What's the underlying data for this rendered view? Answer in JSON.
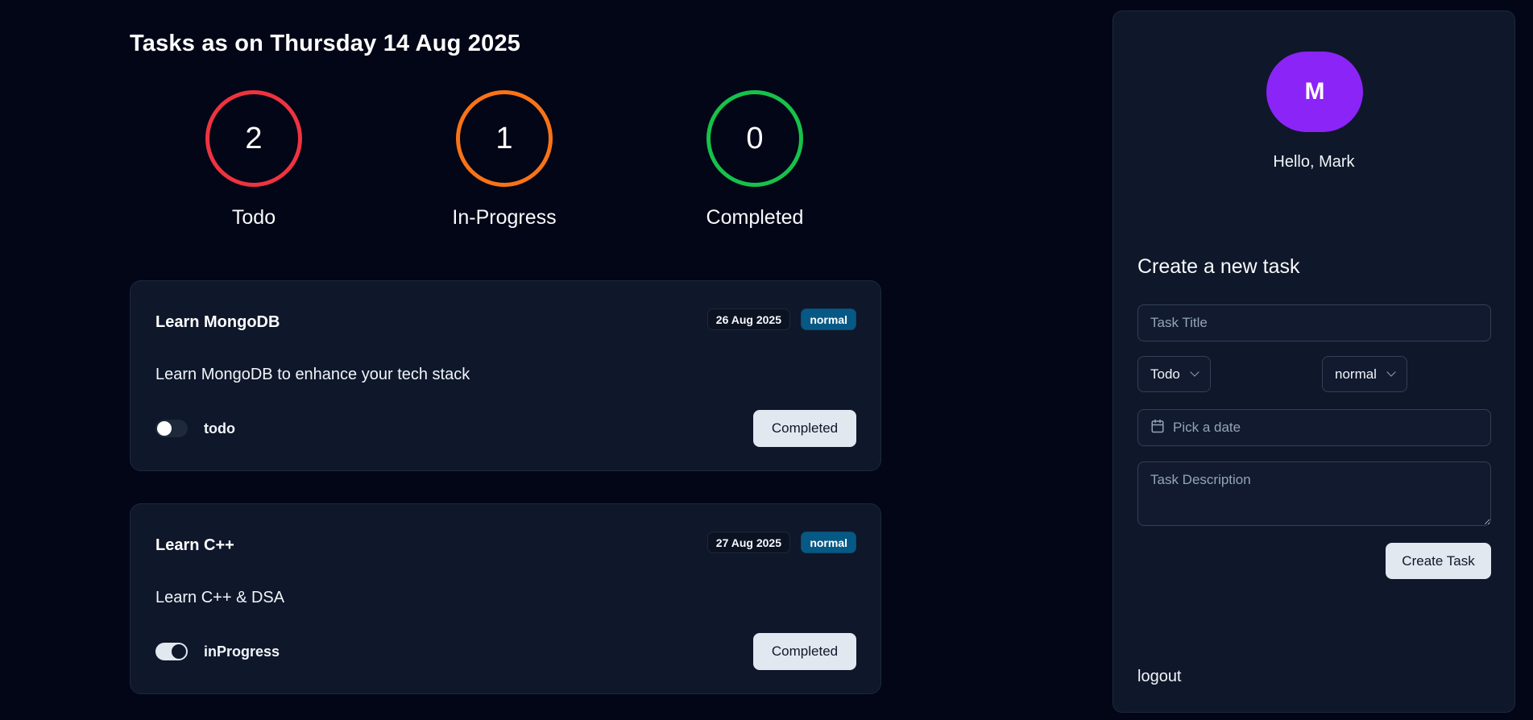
{
  "header": {
    "title": "Tasks as on Thursday 14 Aug 2025"
  },
  "stats": [
    {
      "count": "2",
      "label": "Todo",
      "color": "#ef3340"
    },
    {
      "count": "1",
      "label": "In-Progress",
      "color": "#f97316"
    },
    {
      "count": "0",
      "label": "Completed",
      "color": "#16c24a"
    }
  ],
  "tasks": [
    {
      "title": "Learn MongoDB",
      "date": "26 Aug 2025",
      "priority": "normal",
      "description": "Learn MongoDB to enhance your tech stack",
      "status": "todo",
      "toggle_on": false,
      "action_label": "Completed"
    },
    {
      "title": "Learn C++",
      "date": "27 Aug 2025",
      "priority": "normal",
      "description": "Learn C++ & DSA",
      "status": "inProgress",
      "toggle_on": true,
      "action_label": "Completed"
    }
  ],
  "sidebar": {
    "avatar_initial": "M",
    "avatar_color": "#8b24f7",
    "greeting": "Hello, Mark",
    "form_title": "Create a new task",
    "title_placeholder": "Task Title",
    "status_select": "Todo",
    "priority_select": "normal",
    "date_placeholder": "Pick a date",
    "description_placeholder": "Task Description",
    "create_label": "Create Task",
    "logout_label": "logout"
  }
}
